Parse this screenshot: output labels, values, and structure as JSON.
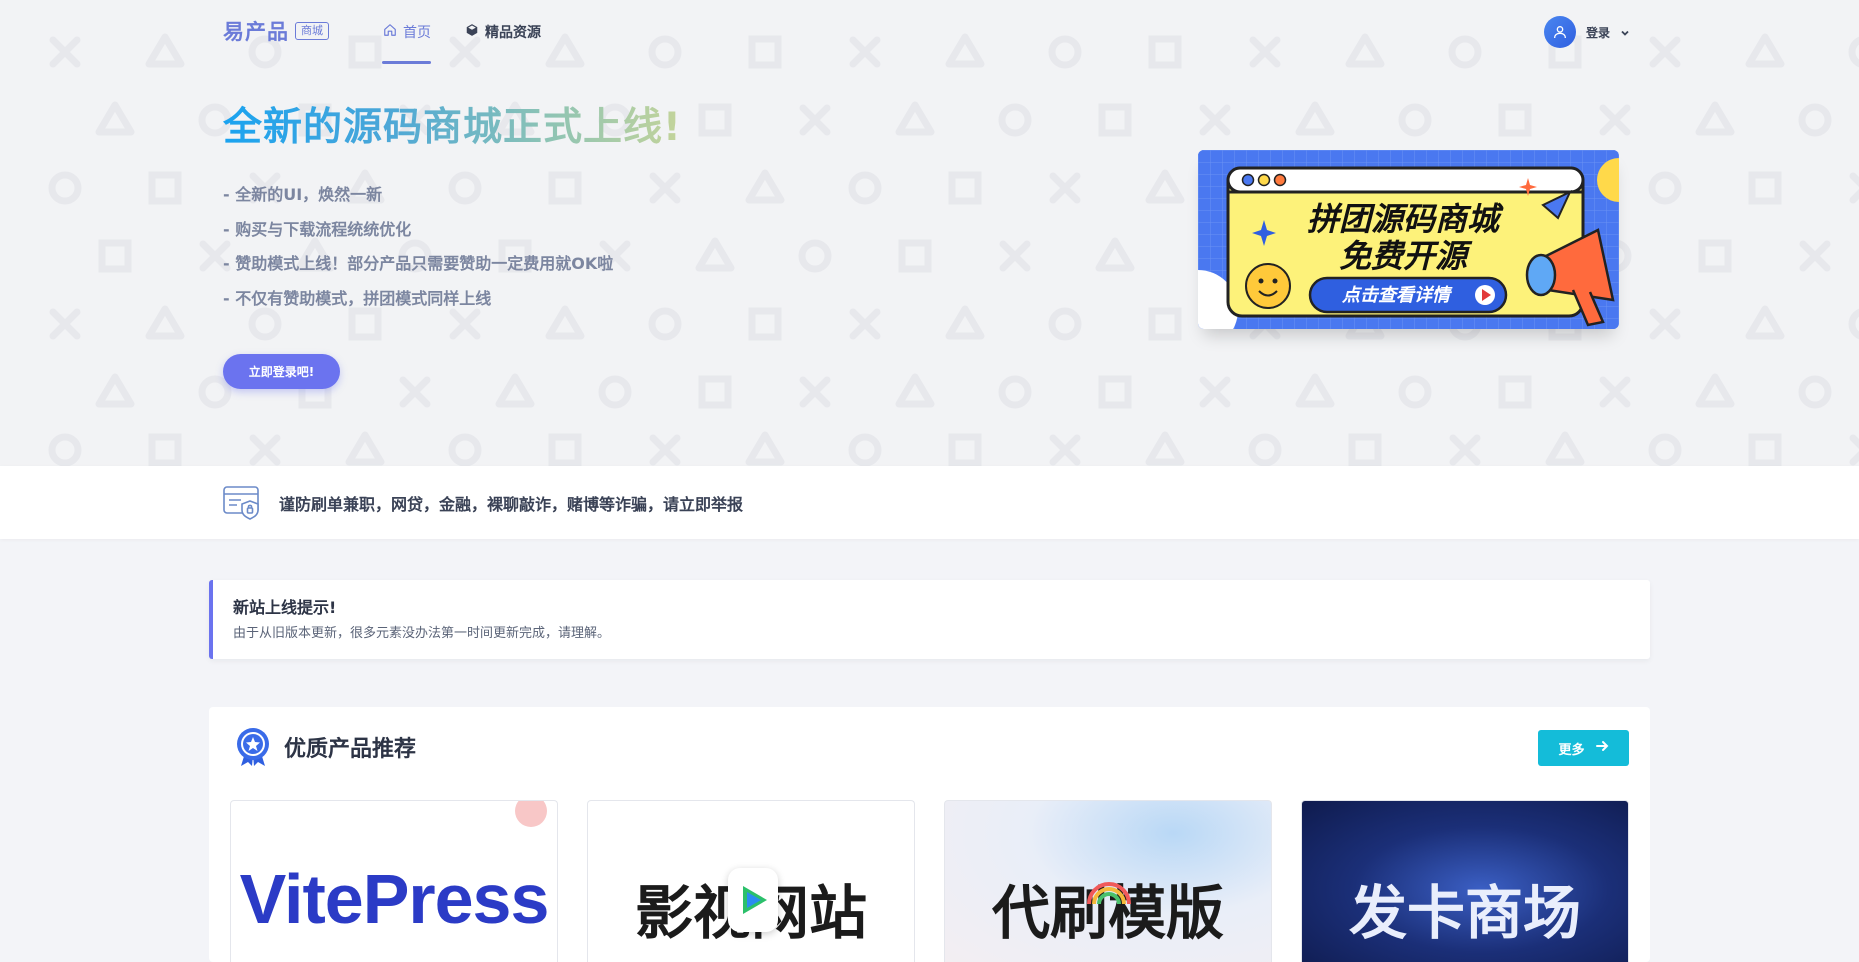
{
  "nav": {
    "brand": "易产品",
    "brand_badge": "商城",
    "items": [
      {
        "label": "首页",
        "icon": "home-icon",
        "active": true
      },
      {
        "label": "精品资源",
        "icon": "cube-icon",
        "active": false
      }
    ],
    "login_label": "登录"
  },
  "hero": {
    "title": "全新的源码商城正式上线!",
    "features": [
      "- 全新的UI，焕然一新",
      "- 购买与下载流程统统优化",
      "- 赞助模式上线！部分产品只需要赞助一定费用就OK啦",
      "- 不仅有赞助模式，拼团模式同样上线"
    ],
    "cta_label": "立即登录吧!",
    "banner": {
      "line1": "拼团源码商城",
      "line2": "免费开源",
      "button": "点击查看详情"
    }
  },
  "notice": {
    "text": "谨防刷单兼职，网贷，金融，裸聊敲诈，赌博等诈骗，请立即举报"
  },
  "alert": {
    "title": "新站上线提示!",
    "body": "由于从旧版本更新，很多元素没办法第一时间更新完成，请理解。"
  },
  "products": {
    "title": "优质产品推荐",
    "more_label": "更多",
    "cards": [
      {
        "text": "VitePress"
      },
      {
        "text": "影视网站"
      },
      {
        "text": "代刷模版"
      },
      {
        "text": "发卡商场"
      }
    ]
  },
  "colors": {
    "accent": "#6b73ef",
    "brand": "#6b7bd8",
    "more_button": "#14bcd9"
  }
}
